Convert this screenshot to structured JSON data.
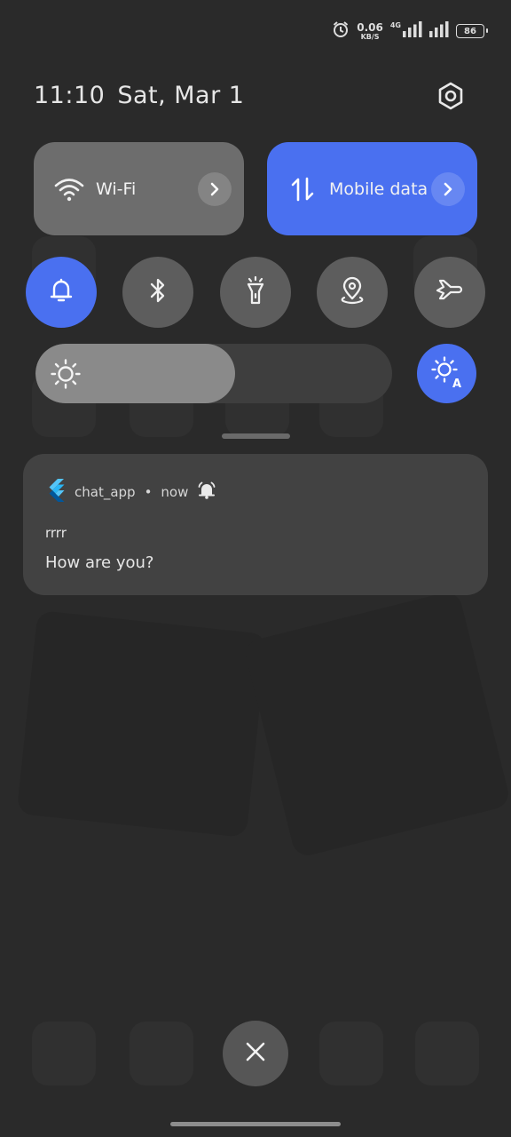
{
  "status_bar": {
    "speed_value": "0.06",
    "speed_unit": "KB/S",
    "network_type": "4G",
    "battery": "86",
    "icons": [
      "alarm-icon",
      "signal-icon",
      "signal-icon",
      "battery-icon"
    ]
  },
  "header": {
    "time": "11:10",
    "date": "Sat, Mar 1",
    "settings_icon": "gear-icon"
  },
  "tiles": {
    "wifi": {
      "label": "Wi-Fi",
      "icon": "wifi-icon",
      "active": false
    },
    "mobile": {
      "label": "Mobile data",
      "icon": "data-arrows-icon",
      "active": true
    }
  },
  "toggles": [
    {
      "name": "notifications",
      "icon": "bell-icon",
      "active": true
    },
    {
      "name": "bluetooth",
      "icon": "bluetooth-icon",
      "active": false
    },
    {
      "name": "flashlight",
      "icon": "flashlight-icon",
      "active": false
    },
    {
      "name": "location",
      "icon": "location-icon",
      "active": false
    },
    {
      "name": "airplane",
      "icon": "airplane-icon",
      "active": false
    }
  ],
  "brightness": {
    "level": 0.56,
    "auto": true
  },
  "notification": {
    "app_name": "chat_app",
    "time": "now",
    "title": "rrrr",
    "message": "How are you?",
    "app_icon": "flutter-icon",
    "alert_icon": "bell-ring-icon"
  },
  "colors": {
    "accent": "#4a70f0",
    "background": "#2a2a2a",
    "tile_inactive": "#6d6d6d",
    "card": "#424242"
  }
}
